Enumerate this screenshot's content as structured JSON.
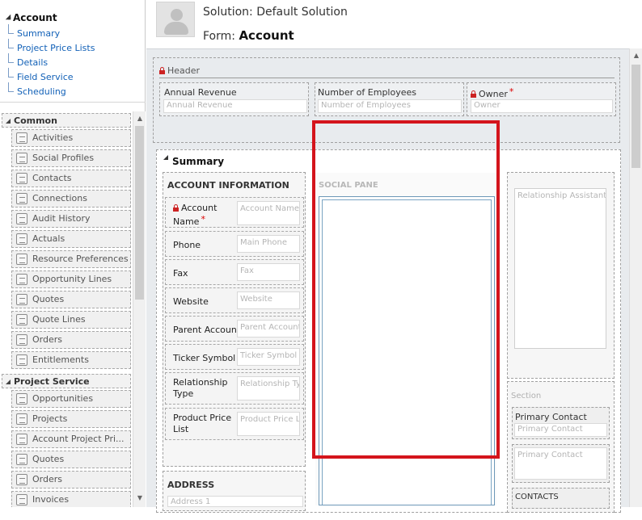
{
  "nav": {
    "title": "Account",
    "links": [
      "Summary",
      "Project Price Lists",
      "Details",
      "Field Service",
      "Scheduling"
    ]
  },
  "related": {
    "groups": [
      {
        "label": "Common",
        "items": [
          "Activities",
          "Social Profiles",
          "Contacts",
          "Connections",
          "Audit History",
          "Actuals",
          "Resource Preferences",
          "Opportunity Lines",
          "Quotes",
          "Quote Lines",
          "Orders",
          "Entitlements"
        ]
      },
      {
        "label": "Project Service",
        "items": [
          "Opportunities",
          "Projects",
          "Account Project Pri...",
          "Quotes",
          "Orders",
          "Invoices"
        ]
      }
    ]
  },
  "header": {
    "solution": "Solution: Default Solution",
    "form_prefix": "Form:",
    "form_name": "Account"
  },
  "form": {
    "header_section": {
      "title": "Header",
      "fields": [
        {
          "label": "Annual Revenue",
          "placeholder": "Annual Revenue"
        },
        {
          "label": "Number of Employees",
          "placeholder": "Number of Employees"
        },
        {
          "label": "Owner",
          "placeholder": "Owner",
          "required_mark": "*"
        }
      ]
    },
    "summary_tab": {
      "title": "Summary",
      "account_info": {
        "title": "ACCOUNT INFORMATION",
        "fields": [
          {
            "label": "Account Name",
            "placeholder": "Account Name",
            "required_mark": "*"
          },
          {
            "label": "Phone",
            "placeholder": "Main Phone"
          },
          {
            "label": "Fax",
            "placeholder": "Fax"
          },
          {
            "label": "Website",
            "placeholder": "Website"
          },
          {
            "label": "Parent Account",
            "placeholder": "Parent Account"
          },
          {
            "label": "Ticker Symbol",
            "placeholder": "Ticker Symbol"
          },
          {
            "label": "Relationship Type",
            "placeholder": "Relationship Type"
          },
          {
            "label": "Product Price List",
            "placeholder": "Product Price List"
          }
        ]
      },
      "address_title": "ADDRESS",
      "address_placeholder": "Address 1",
      "social_pane": "SOCIAL PANE",
      "relationship_assistant": "Relationship Assistant",
      "section": {
        "title": "Section",
        "primary_contact_label": "Primary Contact",
        "primary_contact_placeholder": "Primary Contact",
        "primary_contact_card": "Primary Contact",
        "contacts_label": "CONTACTS"
      }
    }
  },
  "colors": {
    "link": "#1160b7",
    "highlight": "#d4141c",
    "required": "#dd0000"
  }
}
